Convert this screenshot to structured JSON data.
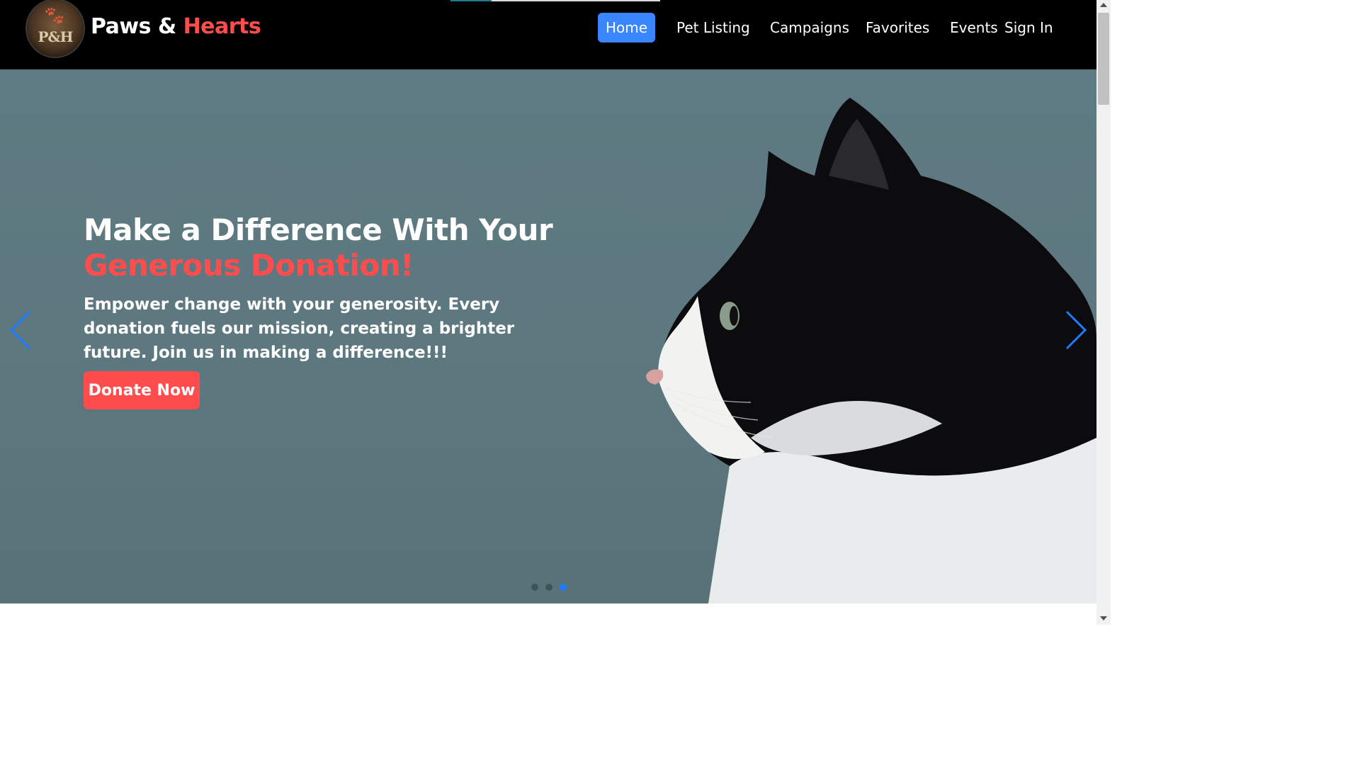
{
  "brand": {
    "name_part1": "Paws & ",
    "name_part2": "Hearts",
    "logo_text": "P&H",
    "accent_color": "#ff4d4d"
  },
  "nav": {
    "items": [
      {
        "label": "Home",
        "active": true
      },
      {
        "label": "Pet Listing"
      },
      {
        "label": "Campaigns"
      },
      {
        "label": "Favorites"
      },
      {
        "label": "Events"
      },
      {
        "label": "Sign In"
      }
    ],
    "active_color": "#3a86ff"
  },
  "hero": {
    "title_line1": "Make a Difference With Your",
    "title_line2": "Generous Donation!",
    "description": "Empower change with your generosity. Every donation fuels our mission, creating a brighter future. Join us in making a difference!!!",
    "cta_label": "Donate Now",
    "slide_count": 3,
    "active_slide": 3,
    "prev_icon": "chevron-left-icon",
    "next_icon": "chevron-right-icon",
    "image_subject": "black-and-white-cat-icon"
  }
}
